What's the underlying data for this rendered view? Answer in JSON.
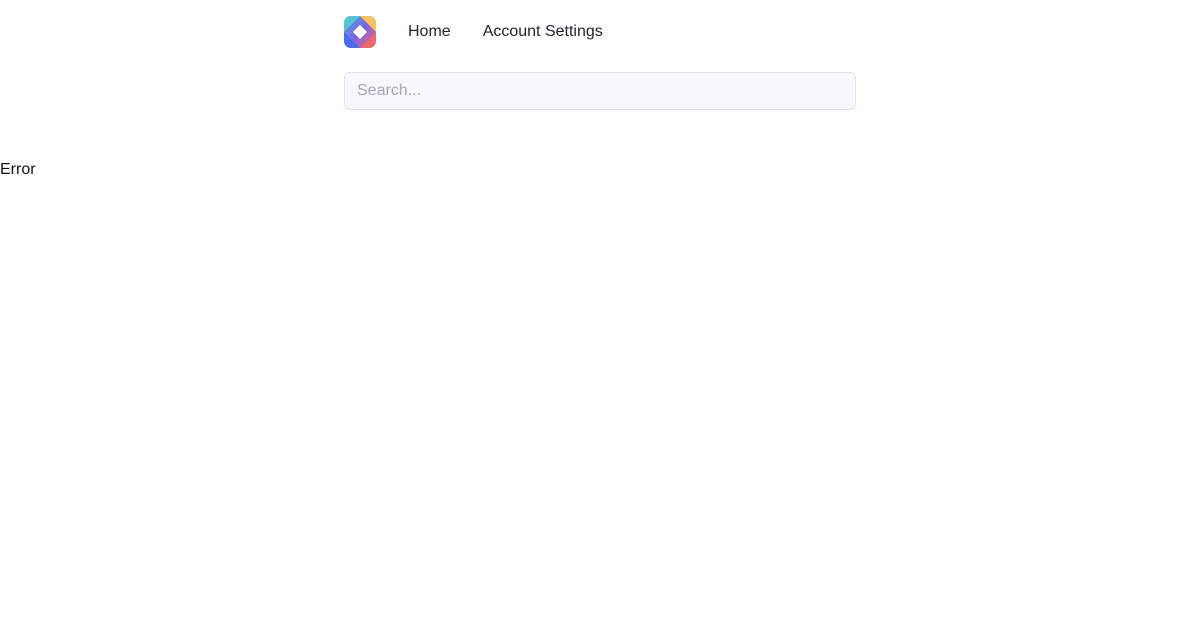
{
  "header": {
    "logo_icon": "app-logo-icon",
    "logo_colors": [
      "#f7c25c",
      "#f06a6a",
      "#3f6ff0",
      "#58c6d4"
    ],
    "nav": {
      "home_label": "Home",
      "account_settings_label": "Account Settings"
    }
  },
  "search": {
    "placeholder": "Search...",
    "value": ""
  },
  "main": {
    "error_text": "Error"
  }
}
